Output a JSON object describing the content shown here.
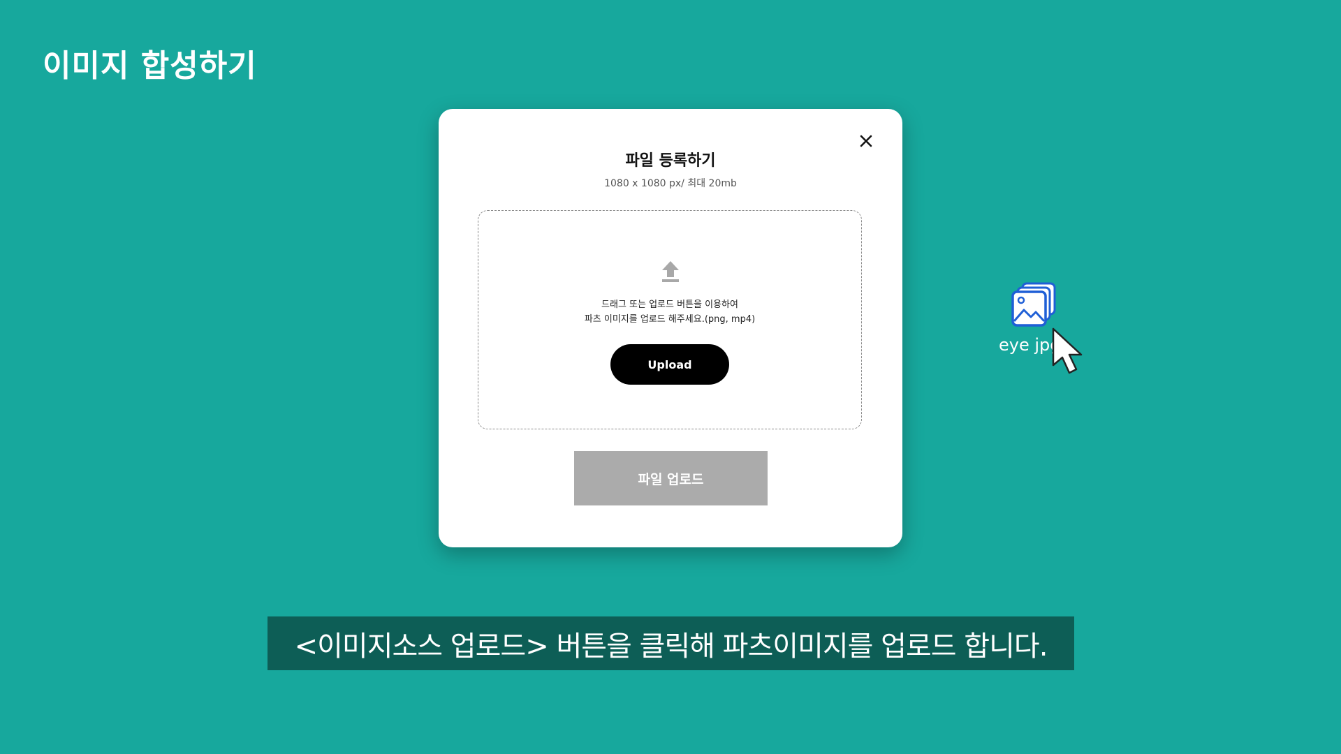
{
  "page": {
    "title": "이미지 합성하기"
  },
  "modal": {
    "title": "파일 등록하기",
    "subtitle": "1080 x 1080 px/ 최대 20mb",
    "close_icon": "close-icon",
    "dropzone": {
      "icon": "upload-arrow-icon",
      "line1": "드래그 또는 업로드 버튼을 이용하여",
      "line2": "파츠 이미지를 업로드 해주세요.(png, mp4)",
      "upload_label": "Upload"
    },
    "submit_label": "파일 업로드"
  },
  "dragged_file": {
    "icon": "image-files-icon",
    "label": "eye jpg"
  },
  "caption": {
    "text": "<이미지소스 업로드> 버튼을 클릭해 파츠이미지를 업로드 합니다."
  },
  "colors": {
    "background": "#17a89d",
    "caption_bg": "#0d5e56",
    "file_icon": "#1f5fd6",
    "disabled_button": "#ababab"
  }
}
